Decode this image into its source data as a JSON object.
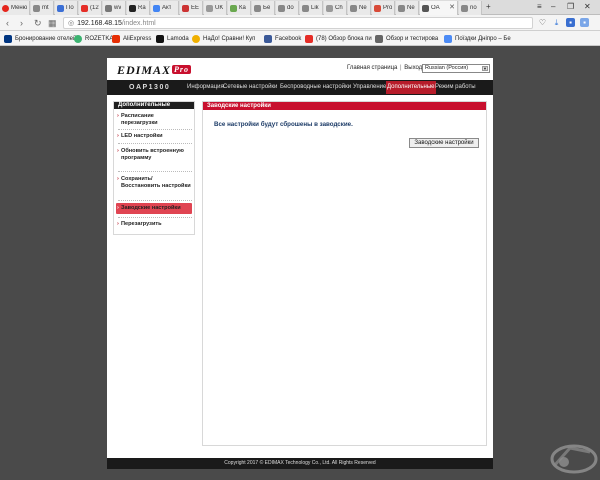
{
  "browser": {
    "tabs": [
      {
        "label": "Меню",
        "color": "#e5251c",
        "active": false
      },
      {
        "label": "mt",
        "color": "#888888",
        "active": false
      },
      {
        "label": "По",
        "color": "#3b6fd6",
        "active": false
      },
      {
        "label": "(12",
        "color": "#e52d27",
        "active": false
      },
      {
        "label": "wv",
        "color": "#777777",
        "active": false
      },
      {
        "label": "Ra",
        "color": "#222222",
        "active": false
      },
      {
        "label": "Акт",
        "color": "#4285f4",
        "active": false
      },
      {
        "label": "EE",
        "color": "#cc3333",
        "active": false
      },
      {
        "label": "UK",
        "color": "#999999",
        "active": false
      },
      {
        "label": "Ка",
        "color": "#6aa84f",
        "active": false
      },
      {
        "label": "Бе",
        "color": "#888888",
        "active": false
      },
      {
        "label": "do",
        "color": "#888888",
        "active": false
      },
      {
        "label": "Lik",
        "color": "#888888",
        "active": false
      },
      {
        "label": "Ch",
        "color": "#999999",
        "active": false
      },
      {
        "label": "Ne",
        "color": "#888888",
        "active": false
      },
      {
        "label": "Pro",
        "color": "#d84a38",
        "active": false
      },
      {
        "label": "Ne",
        "color": "#888888",
        "active": false
      },
      {
        "label": "OA",
        "color": "#555555",
        "active": true
      },
      {
        "label": "no",
        "color": "#888888",
        "active": false
      }
    ],
    "url_host": "192.168.48.15",
    "url_path": "/index.html",
    "bookmarks": [
      {
        "label": "Бронирование отелей",
        "color": "#003580"
      },
      {
        "label": "ROZETKA",
        "color": "#3cb371"
      },
      {
        "label": "AliExpress",
        "color": "#e62e04"
      },
      {
        "label": "Lamoda",
        "color": "#111111"
      },
      {
        "label": "НаДо! Сравни! Куп",
        "color": "#f0b000"
      },
      {
        "label": "Facebook",
        "color": "#3b5998"
      },
      {
        "label": "(78) Обзор блока пи",
        "color": "#e52d27"
      },
      {
        "label": "Обзор и тестирова",
        "color": "#666666"
      },
      {
        "label": "Поїздки Дніпро – Бе",
        "color": "#4c8bf5"
      }
    ]
  },
  "router": {
    "logo_text": "EDIMAX",
    "logo_badge": "Pro",
    "top_link_home": "Главная страница",
    "top_link_sep": "|",
    "top_link_logout": "Выход",
    "language": "Russian (Россия)",
    "model": "OAP1300",
    "menu": [
      {
        "label": "Информация",
        "active": false
      },
      {
        "label": "Сетевые настройки",
        "active": false
      },
      {
        "label": "Беспроводные настройки",
        "active": false
      },
      {
        "label": "Управление",
        "active": false
      },
      {
        "label": "Дополнительные",
        "active": true
      },
      {
        "label": "Режим работы",
        "active": false
      }
    ],
    "sidebar_title": "Дополнительные",
    "sidebar_items": [
      {
        "label": "Расписание перезагрузки",
        "active": false
      },
      {
        "label": "LED настройки",
        "active": false
      },
      {
        "label": "Обновить встроенную программу",
        "active": false
      },
      {
        "label": "Сохранить/ Восстановить настройки",
        "active": false
      },
      {
        "label": "Заводские настройки",
        "active": true
      },
      {
        "label": "Перезагрузить",
        "active": false
      }
    ],
    "content_title": "Заводские настройки",
    "content_message": "Все настройки будут сброшены в заводские.",
    "factory_button": "Заводские настройки",
    "footer": "Copyright 2017 © EDIMAX Technology Co., Ltd. All Rights Reserved"
  },
  "watermark": {
    "text": "GECID.com"
  }
}
